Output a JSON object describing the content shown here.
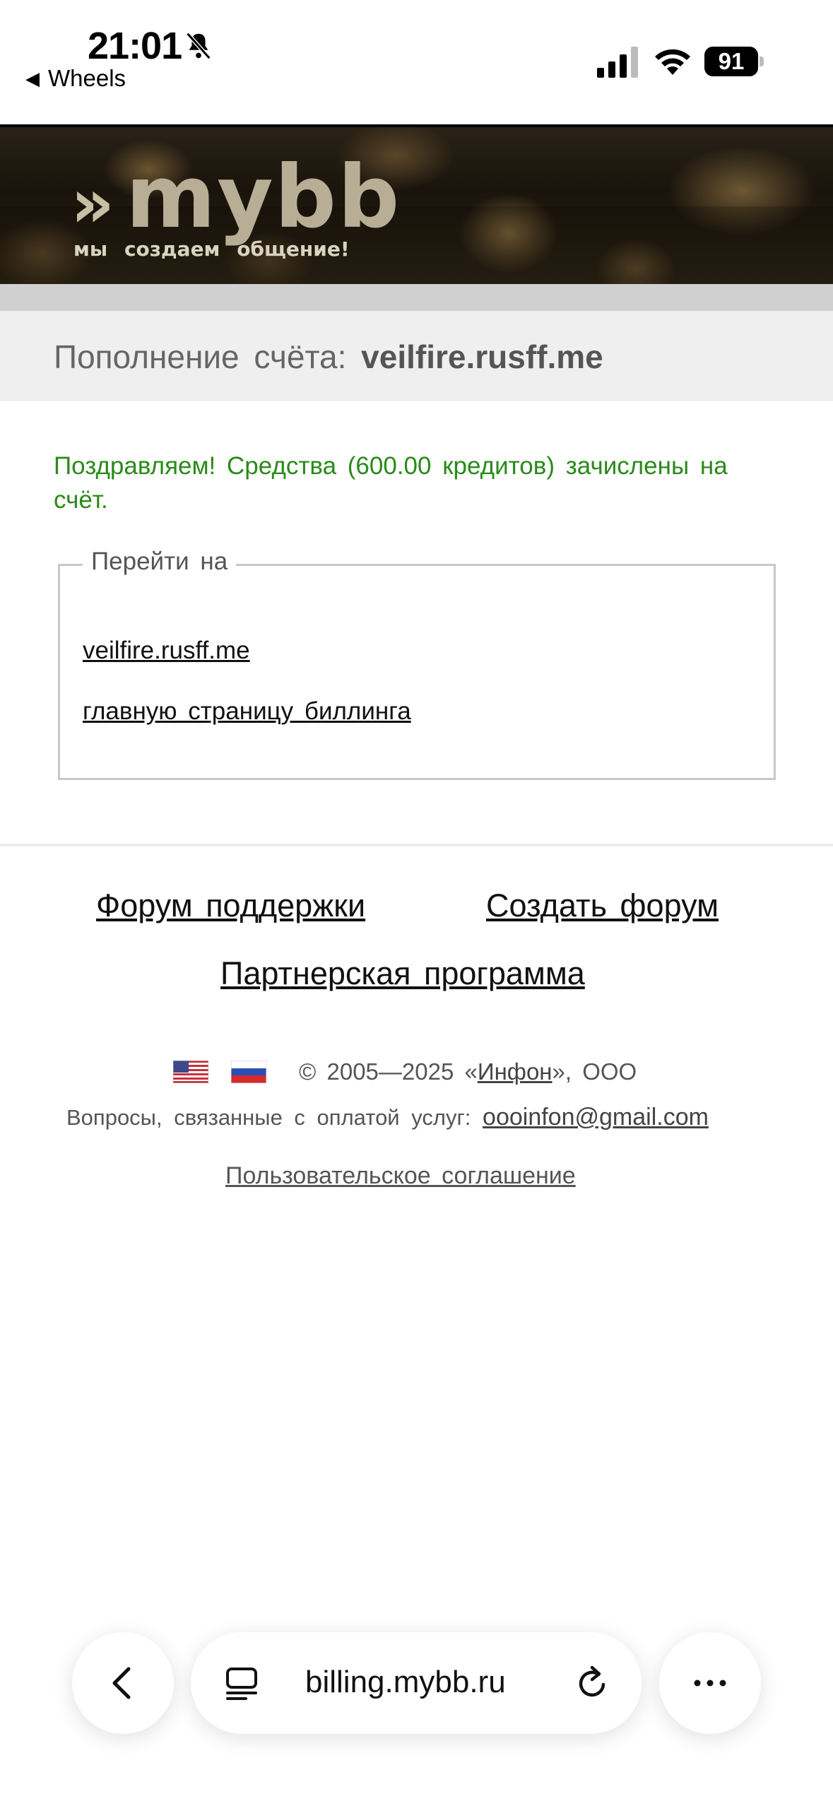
{
  "status_bar": {
    "time": "21:01",
    "back_app": "Wheels",
    "battery": "91"
  },
  "banner": {
    "logo_mark": "»",
    "logo_text": "mybb",
    "tagline": "мы создаем общение!"
  },
  "header": {
    "title_prefix": "Пополнение счёта:",
    "title_domain": "veilfire.rusff.me"
  },
  "main": {
    "success_message": "Поздравляем! Средства (600.00 кредитов) зачислены на счёт.",
    "goto_legend": "Перейти на",
    "goto_links": [
      "veilfire.rusff.me",
      "главную страницу биллинга"
    ]
  },
  "footer": {
    "links": {
      "support_forum": "Форум поддержки",
      "create_forum": "Создать форум",
      "partner_program": "Партнерская программа"
    },
    "copyright_prefix": "© 2005—2025 «",
    "company_link": "Инфон",
    "copyright_suffix": "», ООО",
    "contact_label": "Вопросы, связанные с оплатой услуг:",
    "contact_email": "oooinfon@gmail.com",
    "agreement": "Пользовательское соглашение",
    "flags": [
      "us-flag-icon",
      "ru-flag-icon"
    ]
  },
  "browser": {
    "url": "billing.mybb.ru"
  },
  "colors": {
    "success_green": "#2a8a1a",
    "header_bg": "#efefef",
    "header_text": "#666666"
  }
}
